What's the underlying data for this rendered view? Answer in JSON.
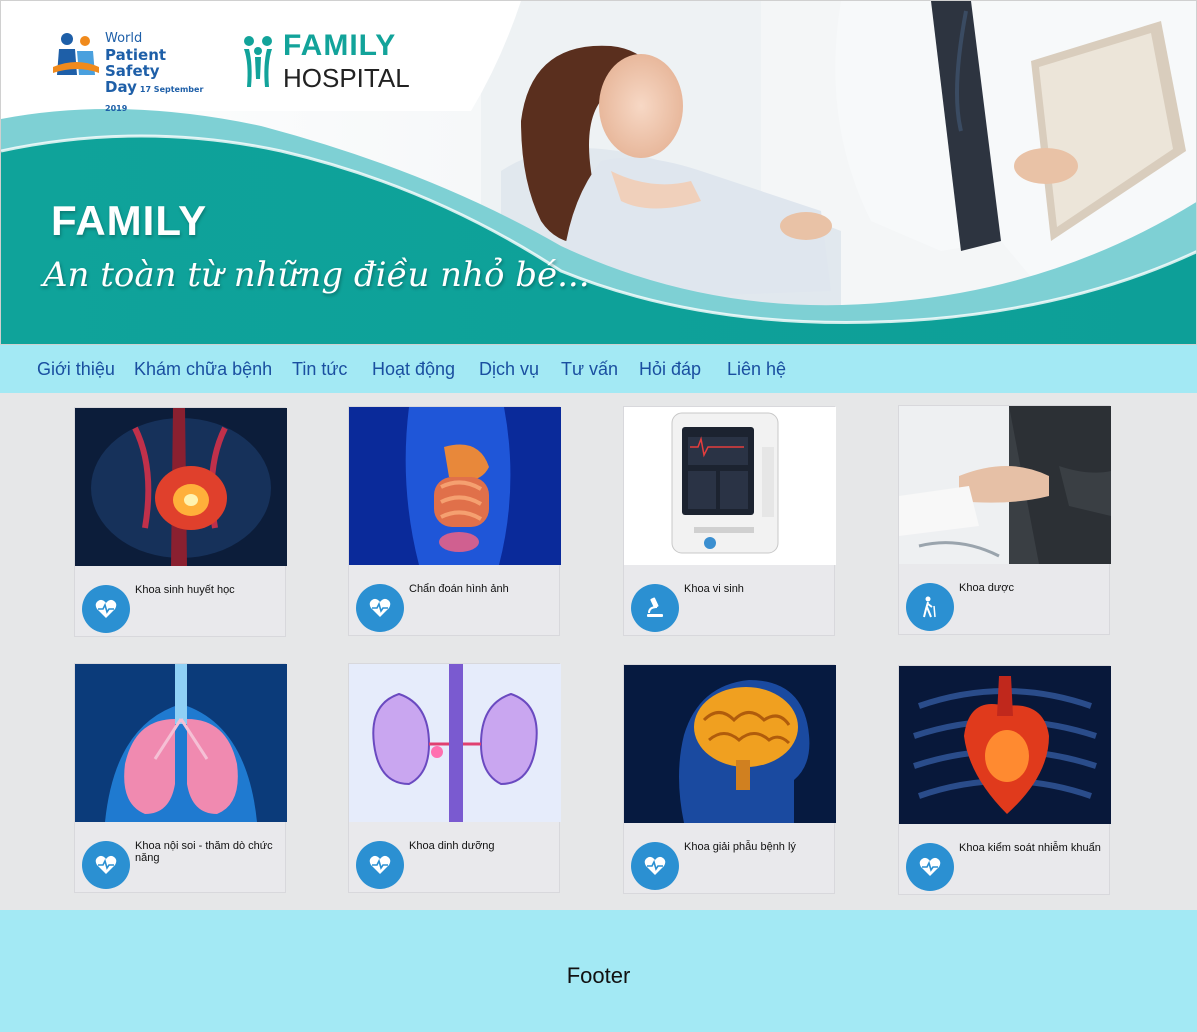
{
  "banner": {
    "wpsd_line1": "World",
    "wpsd_line2": "Patient Safety",
    "wpsd_line3": "Day",
    "wpsd_date": "17 September 2019",
    "hospital_line1": "FAMILY",
    "hospital_line2": "HOSPITAL",
    "title": "FAMILY",
    "slogan": "An toàn từ những điều nhỏ bé..."
  },
  "nav": {
    "items": [
      {
        "label": "Giới thiệu"
      },
      {
        "label": "Khám chữa bệnh"
      },
      {
        "label": "Tin tức"
      },
      {
        "label": "Hoạt động"
      },
      {
        "label": "Dịch vụ"
      },
      {
        "label": "Tư vấn"
      },
      {
        "label": "Hỏi đáp"
      },
      {
        "label": "Liên hệ"
      }
    ]
  },
  "departments": [
    {
      "name": "Khoa sinh huyết học",
      "icon": "heart-pulse-icon"
    },
    {
      "name": "Chẩn đoán hình ảnh",
      "icon": "heart-pulse-icon"
    },
    {
      "name": "Khoa vi sinh",
      "icon": "microscope-icon"
    },
    {
      "name": "Khoa dược",
      "icon": "walking-cane-icon"
    },
    {
      "name": "Khoa nội soi - thăm dò chức năng",
      "icon": "heart-pulse-icon"
    },
    {
      "name": "Khoa dinh dưỡng",
      "icon": "heart-pulse-icon"
    },
    {
      "name": "Khoa giải phẫu bệnh lý",
      "icon": "heart-pulse-icon"
    },
    {
      "name": "Khoa kiểm soát nhiễm khuẩn",
      "icon": "heart-pulse-icon"
    }
  ],
  "footer": {
    "label": "Footer"
  },
  "colors": {
    "accent": "#12a39a",
    "nav_bg": "#a3e9f4",
    "icon_bg": "#2b90d2",
    "link": "#1a4fa0"
  }
}
